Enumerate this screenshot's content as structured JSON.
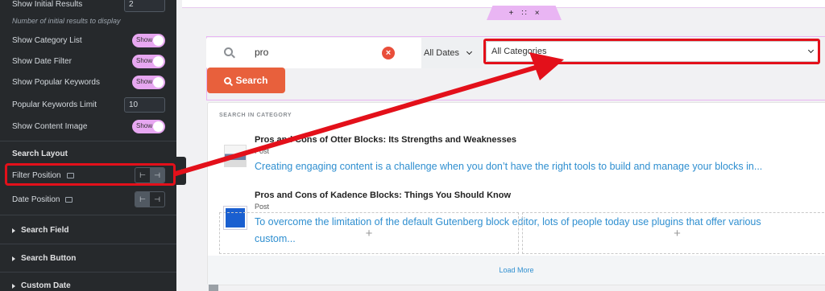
{
  "panel": {
    "show_initial_results": {
      "label": "Show Initial Results",
      "value": "2"
    },
    "initial_hint": "Number of initial results to display",
    "toggles": [
      {
        "label": "Show Category List",
        "state": "Show"
      },
      {
        "label": "Show Date Filter",
        "state": "Show"
      },
      {
        "label": "Show Popular Keywords",
        "state": "Show"
      }
    ],
    "popular_limit": {
      "label": "Popular Keywords Limit",
      "value": "10"
    },
    "content_image": {
      "label": "Show Content Image",
      "state": "Show"
    },
    "search_layout": "Search Layout",
    "filter_position": "Filter Position",
    "date_position": "Date Position",
    "pos_left_glyph": "⊢",
    "pos_right_glyph": "⊣",
    "accordions": [
      "Search Field",
      "Search Button",
      "Custom Date"
    ],
    "collapse_glyph": "‹"
  },
  "canvas": {
    "handle": {
      "add": "+",
      "move": "∷",
      "close": "×"
    },
    "search_value": "pro",
    "clear_glyph": "×",
    "date_filter": "All Dates",
    "category_filter": "All Categories",
    "search_button": "Search",
    "results_heading": "SEARCH IN CATEGORY",
    "results": [
      {
        "title": "Pros and Cons of Otter Blocks: Its Strengths and Weaknesses",
        "type": "Post",
        "excerpt": "Creating engaging content is a challenge when you don’t have the right tools to build and manage your blocks in..."
      },
      {
        "title": "Pros and Cons of Kadence Blocks: Things You Should Know",
        "type": "Post",
        "excerpt": "To overcome the limitation of the default Gutenberg block editor, lots of people today use plugins that offer various custom..."
      }
    ],
    "plus": "+",
    "load_more": "Load More"
  },
  "colors": {
    "annotation": "#e3101a",
    "accent_button": "#e8603c",
    "link": "#2f8fd0",
    "toggle": "#e7a7f1",
    "panel_bg": "#26292c"
  }
}
